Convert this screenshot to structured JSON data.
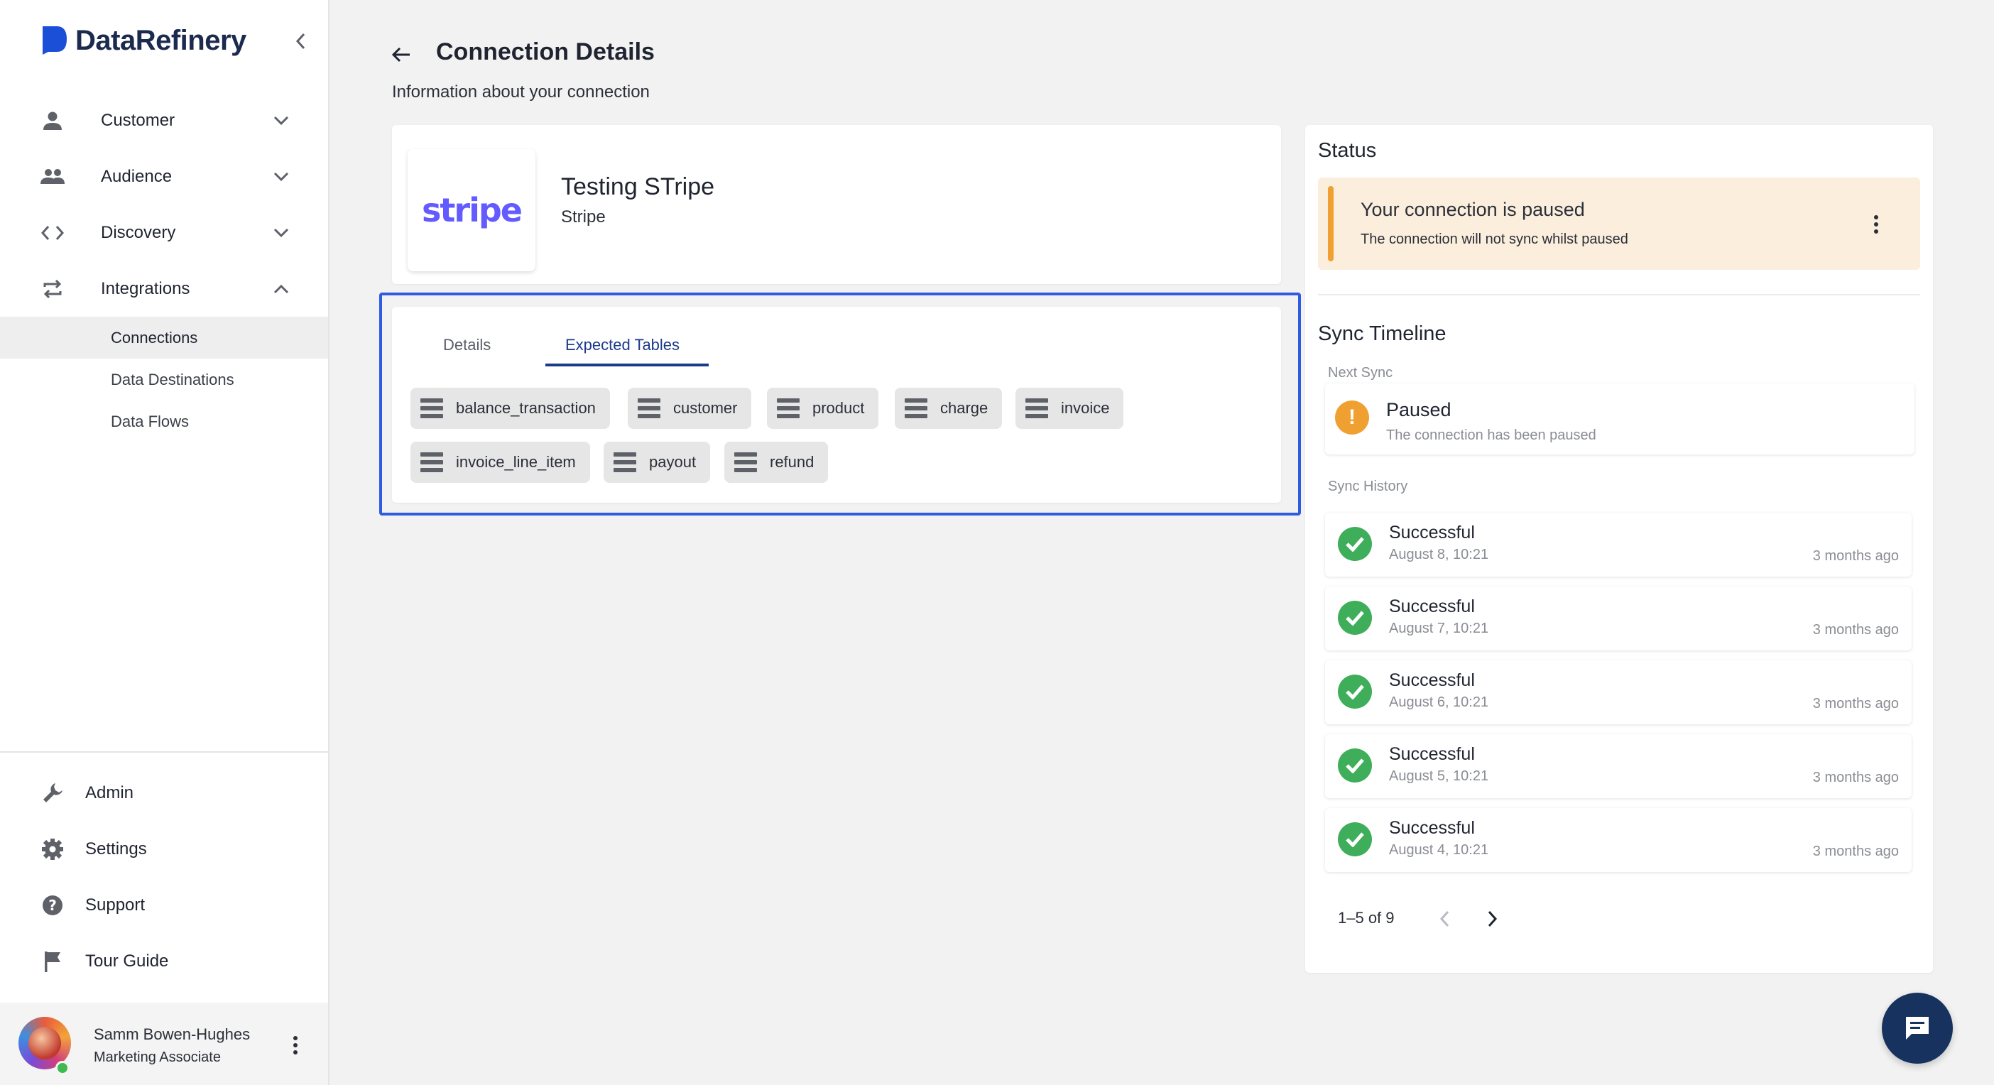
{
  "brand": {
    "name": "DataRefinery",
    "color": "#1b4fd8"
  },
  "nav": {
    "items": [
      {
        "label": "Customer",
        "icon": "person-icon",
        "expanded": false
      },
      {
        "label": "Audience",
        "icon": "group-icon",
        "expanded": false
      },
      {
        "label": "Discovery",
        "icon": "code-icon",
        "expanded": false
      },
      {
        "label": "Integrations",
        "icon": "sync-arrows-icon",
        "expanded": true
      }
    ],
    "sub_items": [
      "Connections",
      "Data Destinations",
      "Data Flows"
    ],
    "active_sub_item": "Connections"
  },
  "bottom_nav": [
    {
      "label": "Admin",
      "icon": "wrench-icon"
    },
    {
      "label": "Settings",
      "icon": "gear-icon"
    },
    {
      "label": "Support",
      "icon": "help-icon"
    },
    {
      "label": "Tour Guide",
      "icon": "flag-icon"
    }
  ],
  "user": {
    "name": "Samm Bowen-Hughes",
    "role": "Marketing Associate",
    "status": "online"
  },
  "page": {
    "title": "Connection Details",
    "subtitle": "Information about your connection"
  },
  "connection": {
    "logo_text": "stripe",
    "name": "Testing STripe",
    "type": "Stripe"
  },
  "tabs": [
    {
      "label": "Details",
      "active": false
    },
    {
      "label": "Expected Tables",
      "active": true
    }
  ],
  "expected_tables": [
    "balance_transaction",
    "customer",
    "product",
    "charge",
    "invoice",
    "invoice_line_item",
    "payout",
    "refund"
  ],
  "status": {
    "title": "Status",
    "alert_title": "Your connection is paused",
    "alert_sub": "The connection will not sync whilst paused",
    "alert_color": "#f0a030"
  },
  "timeline": {
    "title": "Sync Timeline",
    "next_sync_label": "Next Sync",
    "next_sync_status": "Paused",
    "next_sync_desc": "The connection has been paused",
    "history_label": "Sync History",
    "history": [
      {
        "status": "Successful",
        "date": "August 8, 10:21",
        "ago": "3 months ago"
      },
      {
        "status": "Successful",
        "date": "August 7, 10:21",
        "ago": "3 months ago"
      },
      {
        "status": "Successful",
        "date": "August 6, 10:21",
        "ago": "3 months ago"
      },
      {
        "status": "Successful",
        "date": "August 5, 10:21",
        "ago": "3 months ago"
      },
      {
        "status": "Successful",
        "date": "August 4, 10:21",
        "ago": "3 months ago"
      }
    ],
    "pager": "1–5 of 9"
  }
}
